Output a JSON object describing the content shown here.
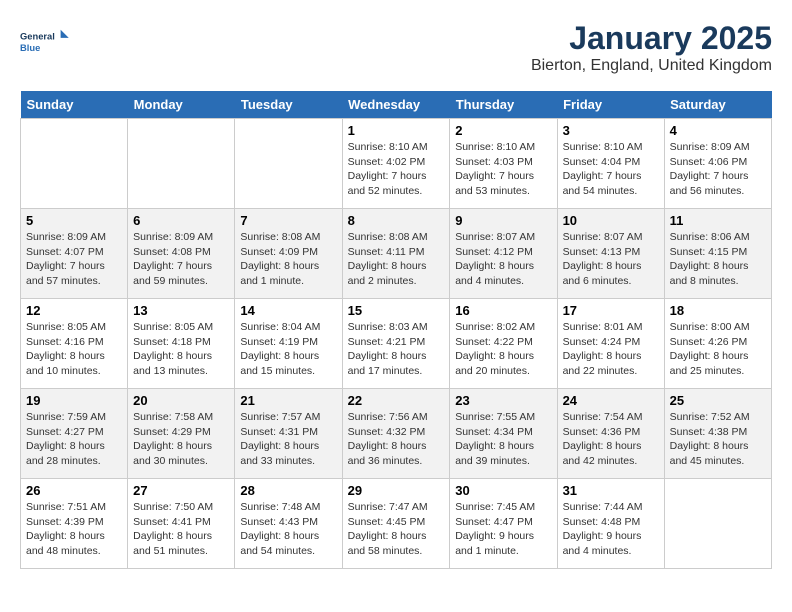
{
  "logo": {
    "line1": "General",
    "line2": "Blue"
  },
  "title": "January 2025",
  "location": "Bierton, England, United Kingdom",
  "days_of_week": [
    "Sunday",
    "Monday",
    "Tuesday",
    "Wednesday",
    "Thursday",
    "Friday",
    "Saturday"
  ],
  "weeks": [
    [
      {
        "day": "",
        "info": ""
      },
      {
        "day": "",
        "info": ""
      },
      {
        "day": "",
        "info": ""
      },
      {
        "day": "1",
        "info": "Sunrise: 8:10 AM\nSunset: 4:02 PM\nDaylight: 7 hours\nand 52 minutes."
      },
      {
        "day": "2",
        "info": "Sunrise: 8:10 AM\nSunset: 4:03 PM\nDaylight: 7 hours\nand 53 minutes."
      },
      {
        "day": "3",
        "info": "Sunrise: 8:10 AM\nSunset: 4:04 PM\nDaylight: 7 hours\nand 54 minutes."
      },
      {
        "day": "4",
        "info": "Sunrise: 8:09 AM\nSunset: 4:06 PM\nDaylight: 7 hours\nand 56 minutes."
      }
    ],
    [
      {
        "day": "5",
        "info": "Sunrise: 8:09 AM\nSunset: 4:07 PM\nDaylight: 7 hours\nand 57 minutes."
      },
      {
        "day": "6",
        "info": "Sunrise: 8:09 AM\nSunset: 4:08 PM\nDaylight: 7 hours\nand 59 minutes."
      },
      {
        "day": "7",
        "info": "Sunrise: 8:08 AM\nSunset: 4:09 PM\nDaylight: 8 hours\nand 1 minute."
      },
      {
        "day": "8",
        "info": "Sunrise: 8:08 AM\nSunset: 4:11 PM\nDaylight: 8 hours\nand 2 minutes."
      },
      {
        "day": "9",
        "info": "Sunrise: 8:07 AM\nSunset: 4:12 PM\nDaylight: 8 hours\nand 4 minutes."
      },
      {
        "day": "10",
        "info": "Sunrise: 8:07 AM\nSunset: 4:13 PM\nDaylight: 8 hours\nand 6 minutes."
      },
      {
        "day": "11",
        "info": "Sunrise: 8:06 AM\nSunset: 4:15 PM\nDaylight: 8 hours\nand 8 minutes."
      }
    ],
    [
      {
        "day": "12",
        "info": "Sunrise: 8:05 AM\nSunset: 4:16 PM\nDaylight: 8 hours\nand 10 minutes."
      },
      {
        "day": "13",
        "info": "Sunrise: 8:05 AM\nSunset: 4:18 PM\nDaylight: 8 hours\nand 13 minutes."
      },
      {
        "day": "14",
        "info": "Sunrise: 8:04 AM\nSunset: 4:19 PM\nDaylight: 8 hours\nand 15 minutes."
      },
      {
        "day": "15",
        "info": "Sunrise: 8:03 AM\nSunset: 4:21 PM\nDaylight: 8 hours\nand 17 minutes."
      },
      {
        "day": "16",
        "info": "Sunrise: 8:02 AM\nSunset: 4:22 PM\nDaylight: 8 hours\nand 20 minutes."
      },
      {
        "day": "17",
        "info": "Sunrise: 8:01 AM\nSunset: 4:24 PM\nDaylight: 8 hours\nand 22 minutes."
      },
      {
        "day": "18",
        "info": "Sunrise: 8:00 AM\nSunset: 4:26 PM\nDaylight: 8 hours\nand 25 minutes."
      }
    ],
    [
      {
        "day": "19",
        "info": "Sunrise: 7:59 AM\nSunset: 4:27 PM\nDaylight: 8 hours\nand 28 minutes."
      },
      {
        "day": "20",
        "info": "Sunrise: 7:58 AM\nSunset: 4:29 PM\nDaylight: 8 hours\nand 30 minutes."
      },
      {
        "day": "21",
        "info": "Sunrise: 7:57 AM\nSunset: 4:31 PM\nDaylight: 8 hours\nand 33 minutes."
      },
      {
        "day": "22",
        "info": "Sunrise: 7:56 AM\nSunset: 4:32 PM\nDaylight: 8 hours\nand 36 minutes."
      },
      {
        "day": "23",
        "info": "Sunrise: 7:55 AM\nSunset: 4:34 PM\nDaylight: 8 hours\nand 39 minutes."
      },
      {
        "day": "24",
        "info": "Sunrise: 7:54 AM\nSunset: 4:36 PM\nDaylight: 8 hours\nand 42 minutes."
      },
      {
        "day": "25",
        "info": "Sunrise: 7:52 AM\nSunset: 4:38 PM\nDaylight: 8 hours\nand 45 minutes."
      }
    ],
    [
      {
        "day": "26",
        "info": "Sunrise: 7:51 AM\nSunset: 4:39 PM\nDaylight: 8 hours\nand 48 minutes."
      },
      {
        "day": "27",
        "info": "Sunrise: 7:50 AM\nSunset: 4:41 PM\nDaylight: 8 hours\nand 51 minutes."
      },
      {
        "day": "28",
        "info": "Sunrise: 7:48 AM\nSunset: 4:43 PM\nDaylight: 8 hours\nand 54 minutes."
      },
      {
        "day": "29",
        "info": "Sunrise: 7:47 AM\nSunset: 4:45 PM\nDaylight: 8 hours\nand 58 minutes."
      },
      {
        "day": "30",
        "info": "Sunrise: 7:45 AM\nSunset: 4:47 PM\nDaylight: 9 hours\nand 1 minute."
      },
      {
        "day": "31",
        "info": "Sunrise: 7:44 AM\nSunset: 4:48 PM\nDaylight: 9 hours\nand 4 minutes."
      },
      {
        "day": "",
        "info": ""
      }
    ]
  ]
}
